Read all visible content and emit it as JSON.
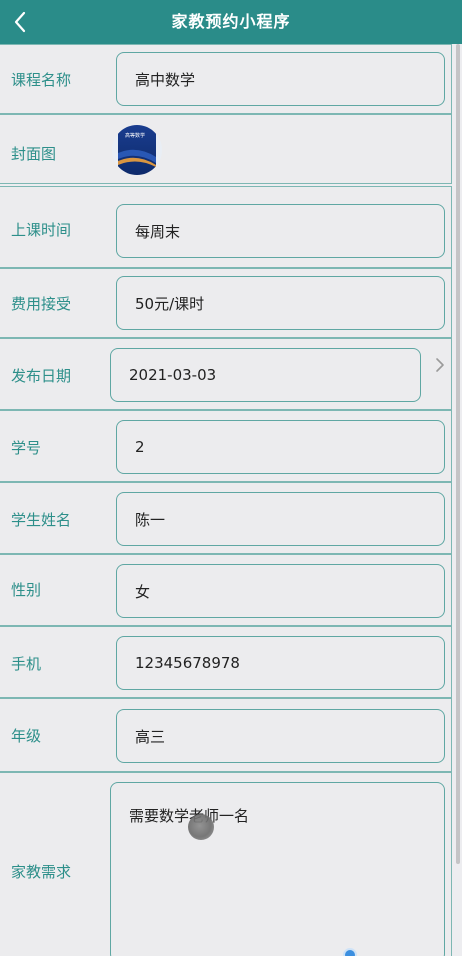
{
  "header": {
    "title": "家教预约小程序",
    "back_icon": "chevron-left-icon"
  },
  "fields": [
    {
      "label": "课程名称",
      "value": "高中数学"
    },
    {
      "label": "封面图"
    },
    {
      "label": "上课时间",
      "value": "每周末"
    },
    {
      "label": "费用接受",
      "value": "50元/课时"
    },
    {
      "label": "发布日期",
      "value": "2021-03-03"
    },
    {
      "label": "学号",
      "value": "2"
    },
    {
      "label": "学生姓名",
      "value": "陈一"
    },
    {
      "label": "性别",
      "value": "女"
    },
    {
      "label": "手机",
      "value": "12345678978"
    },
    {
      "label": "年级",
      "value": "高三"
    },
    {
      "label": "家教需求",
      "value": "需要数学老师一名"
    }
  ],
  "cover_image": {
    "text": "高等数学"
  },
  "colors": {
    "header_bg": "#2a8c89",
    "label": "#2d8f8a",
    "border": "#5fa7a3",
    "page_bg": "#ededf0"
  }
}
